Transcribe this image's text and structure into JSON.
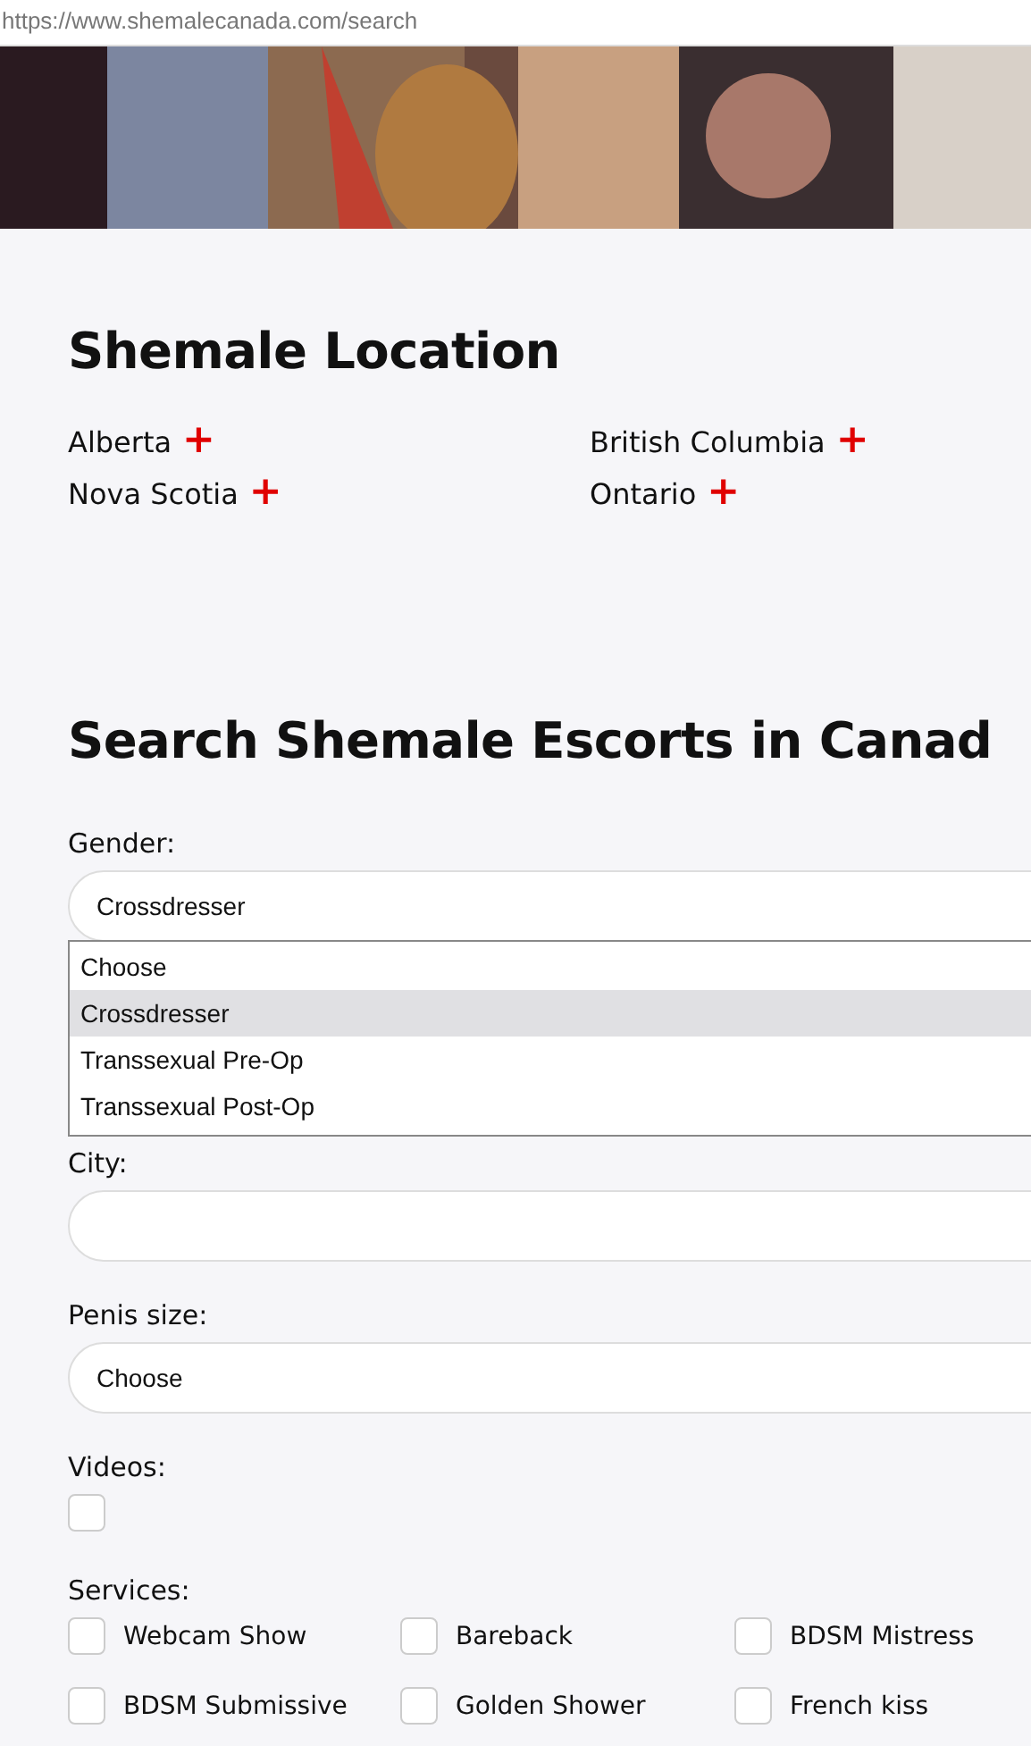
{
  "address_bar": {
    "url": "https://www.shemalecanada.com/search"
  },
  "locations": {
    "title": "Shemale Location",
    "items": [
      {
        "name": "Alberta",
        "expand_icon": "+"
      },
      {
        "name": "British Columbia",
        "expand_icon": "+"
      },
      {
        "name": "Nova Scotia",
        "expand_icon": "+"
      },
      {
        "name": "Ontario",
        "expand_icon": "+"
      }
    ]
  },
  "search": {
    "title": "Search Shemale Escorts in Canad",
    "fields": [
      {
        "kind": "select",
        "label": "Gender:",
        "value": "Crossdresser",
        "expanded": true,
        "options": [
          {
            "label": "Choose",
            "selected": false
          },
          {
            "label": "Crossdresser",
            "selected": true
          },
          {
            "label": "Transsexual Pre-Op",
            "selected": false
          },
          {
            "label": "Transsexual Post-Op",
            "selected": false
          }
        ]
      },
      {
        "kind": "text",
        "label": "City:"
      },
      {
        "kind": "select",
        "label": "Penis size:",
        "value": "Choose"
      },
      {
        "kind": "checkbox",
        "label": "Videos:",
        "checked": false
      },
      {
        "kind": "checkgroup",
        "label": "Services:",
        "items": [
          {
            "label": "Webcam Show",
            "checked": false
          },
          {
            "label": "Bareback",
            "checked": false
          },
          {
            "label": "BDSM Mistress",
            "checked": false
          },
          {
            "label": "BDSM Submissive",
            "checked": false
          },
          {
            "label": "Golden Shower",
            "checked": false
          },
          {
            "label": "French kiss",
            "checked": false
          }
        ]
      }
    ]
  }
}
